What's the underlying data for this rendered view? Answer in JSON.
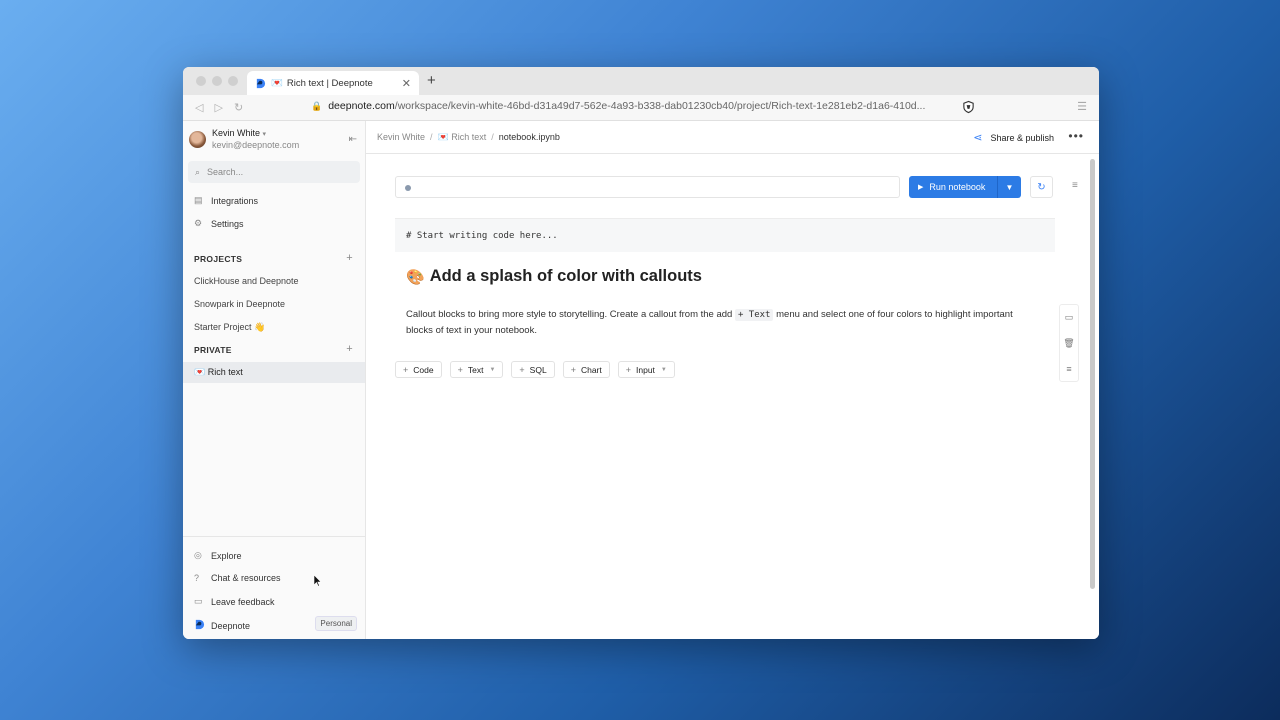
{
  "browser": {
    "tab_title": "Rich text | Deepnote",
    "tab_emoji": "💌",
    "new_tab": "+",
    "close_tab": "✕",
    "url_host": "deepnote.com",
    "url_path": "/workspace/kevin-white-46bd-d31a49d7-562e-4a93-b338-dab01230cb40/project/Rich-text-1e281eb2-d1a6-410d..."
  },
  "sidebar": {
    "user_name": "Kevin White",
    "user_email": "kevin@deepnote.com",
    "search_placeholder": "Search...",
    "nav": [
      {
        "label": "Integrations",
        "icon": "integrations-icon"
      },
      {
        "label": "Settings",
        "icon": "gear-icon"
      }
    ],
    "projects_header": "PROJECTS",
    "projects": [
      "ClickHouse and Deepnote",
      "Snowpark in Deepnote",
      "Starter Project 👋"
    ],
    "private_header": "PRIVATE",
    "private_items": [
      "💌 Rich text"
    ],
    "bottom": [
      {
        "label": "Explore",
        "icon": "compass-icon"
      },
      {
        "label": "Chat & resources",
        "icon": "help-icon"
      },
      {
        "label": "Leave feedback",
        "icon": "message-icon"
      }
    ],
    "workspace_name": "Deepnote",
    "workspace_badge": "Personal"
  },
  "topbar": {
    "breadcrumbs": [
      "Kevin White",
      "💌 Rich text",
      "notebook.ipynb"
    ],
    "share_label": "Share & publish",
    "more": "•••"
  },
  "notebook": {
    "run_label": "Run notebook",
    "code_text": "# Start writing code here...",
    "heading_emoji": "🎨",
    "heading": "Add a splash of color with callouts",
    "para_before": "Callout blocks to bring more style to storytelling. Create a callout from the add ",
    "para_code": "+ Text",
    "para_after": " menu and select one of four colors to highlight important blocks of text in your notebook.",
    "add_buttons": [
      {
        "label": "Code",
        "caret": false
      },
      {
        "label": "Text",
        "caret": true
      },
      {
        "label": "SQL",
        "caret": false
      },
      {
        "label": "Chart",
        "caret": false
      },
      {
        "label": "Input",
        "caret": true
      }
    ]
  },
  "colors": {
    "accent": "#2c7be5",
    "sidebar_bg": "#fafafa"
  }
}
